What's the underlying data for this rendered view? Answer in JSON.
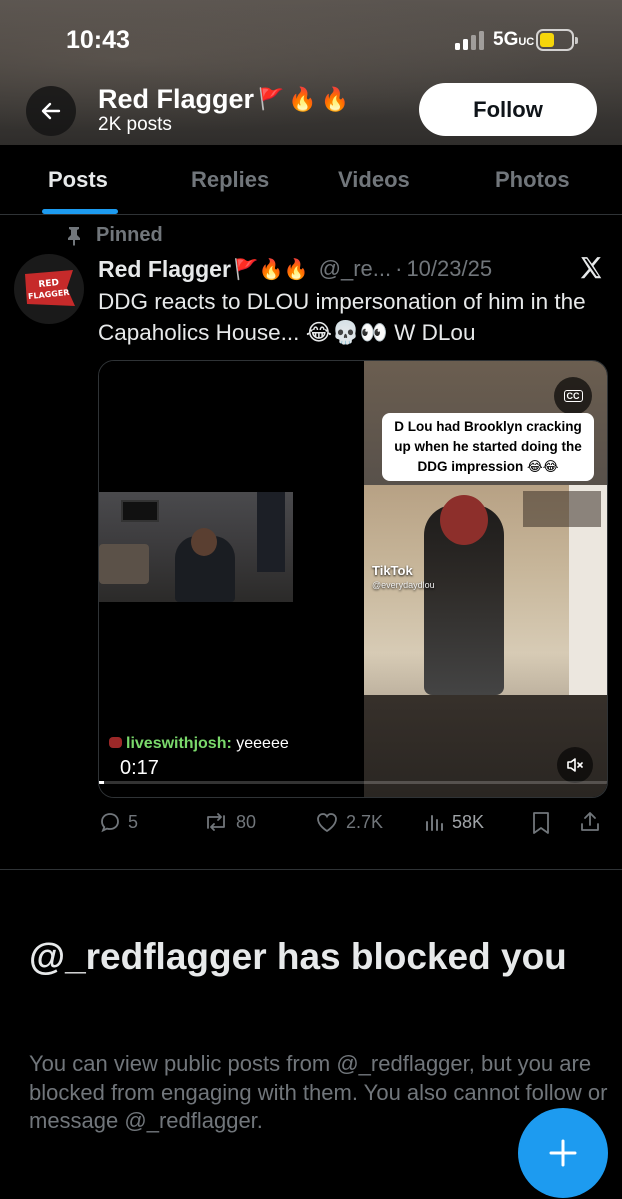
{
  "status_bar": {
    "time": "10:43",
    "network": "5G",
    "network_sub": "UC",
    "battery_level": 0.45
  },
  "header": {
    "name": "Red Flagger",
    "emojis": [
      "🚩",
      "🔥",
      "🔥"
    ],
    "post_count": "2K posts",
    "follow_label": "Follow"
  },
  "tabs": [
    {
      "label": "Posts",
      "active": true
    },
    {
      "label": "Replies",
      "active": false
    },
    {
      "label": "Videos",
      "active": false
    },
    {
      "label": "Photos",
      "active": false
    }
  ],
  "pinned_label": "Pinned",
  "post": {
    "name": "Red Flagger",
    "name_emojis": "🚩🔥🔥",
    "handle": "@_re...",
    "date": "10/23/25",
    "text": "DDG reacts to DLOU impersonation of him in the Capaholics House... 😂💀👀 W DLou",
    "avatar_text": "RED FLAGGER",
    "media": {
      "caption": "D Lou had Brooklyn cracking up when he started doing the DDG impression 😂😂",
      "watermark": "TikTok",
      "watermark_handle": "@everydaydlou",
      "chat_user": "liveswithjosh:",
      "chat_text": "yeeeee",
      "duration": "0:17",
      "progress": 0.01
    },
    "actions": {
      "replies": "5",
      "reposts": "80",
      "likes": "2.7K",
      "views": "58K"
    }
  },
  "blocked": {
    "title": "@_redflagger has blocked you",
    "description": "You can view public posts from @_redflagger, but you are blocked from engaging with them. You also cannot follow or message @_redflagger."
  },
  "colors": {
    "accent": "#1d9bf0",
    "muted": "#71767b",
    "background": "#000000"
  },
  "icons": [
    "arrow-left-icon",
    "pin-icon",
    "x-logo-icon",
    "cc-icon",
    "mute-icon",
    "reply-icon",
    "repost-icon",
    "like-icon",
    "views-icon",
    "bookmark-icon",
    "share-icon",
    "compose-plus-icon"
  ]
}
